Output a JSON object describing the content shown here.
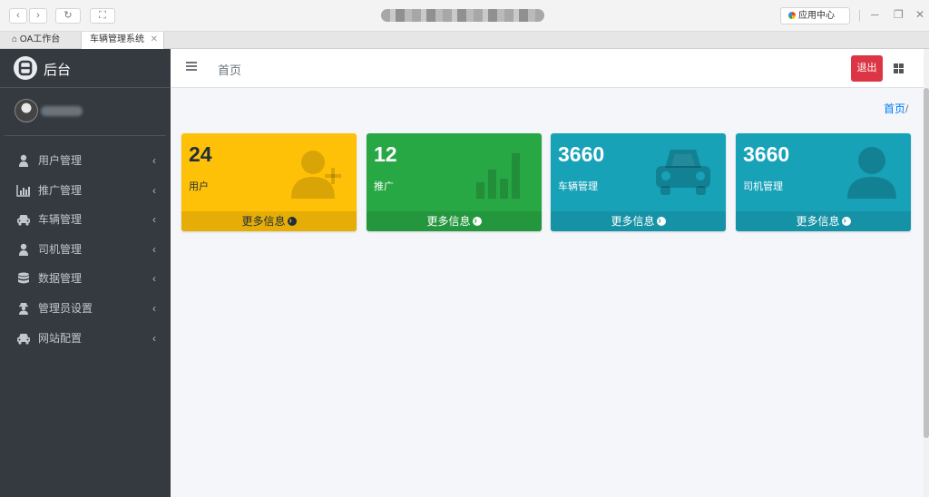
{
  "browser": {
    "tabs": [
      {
        "label": "OA工作台"
      },
      {
        "label": "车辆管理系统"
      }
    ],
    "app_center_label": "应用中心"
  },
  "sidebar": {
    "brand": "后台",
    "items": [
      {
        "label": "用户管理",
        "icon": "user-icon"
      },
      {
        "label": "推广管理",
        "icon": "bar-chart-icon"
      },
      {
        "label": "车辆管理",
        "icon": "car-icon"
      },
      {
        "label": "司机管理",
        "icon": "user-icon"
      },
      {
        "label": "数据管理",
        "icon": "database-icon"
      },
      {
        "label": "管理员设置",
        "icon": "user-secret-icon"
      },
      {
        "label": "网站配置",
        "icon": "car-icon"
      }
    ]
  },
  "topnav": {
    "home_label": "首页",
    "logout_label": "退出"
  },
  "breadcrumb": {
    "home": "首页",
    "separator": "/"
  },
  "stats": [
    {
      "value": "24",
      "label": "用户",
      "footer": "更多信息",
      "color": "#ffc107",
      "footer_color": "#e5ad06",
      "icon": "user-plus-icon"
    },
    {
      "value": "12",
      "label": "推广",
      "footer": "更多信息",
      "color": "#28a745",
      "footer_color": "#24963e",
      "icon": "bar-chart-icon"
    },
    {
      "value": "3660",
      "label": "车辆管理",
      "footer": "更多信息",
      "color": "#17a2b8",
      "footer_color": "#1592a5",
      "icon": "car-icon"
    },
    {
      "value": "3660",
      "label": "司机管理",
      "footer": "更多信息",
      "color": "#17a2b8",
      "footer_color": "#1592a5",
      "icon": "user-icon"
    }
  ]
}
